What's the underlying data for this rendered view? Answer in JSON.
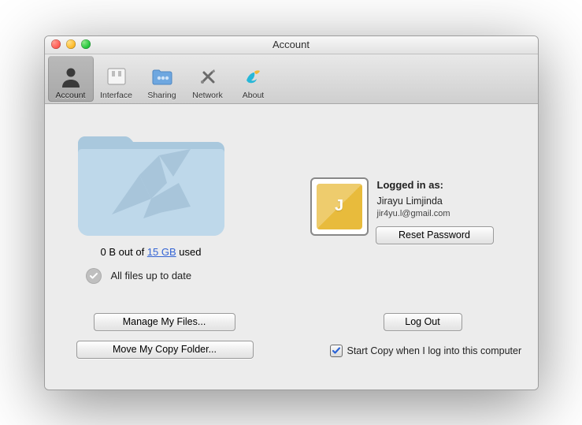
{
  "window": {
    "title": "Account"
  },
  "toolbar": {
    "account": "Account",
    "interface": "Interface",
    "sharing": "Sharing",
    "network": "Network",
    "about": "About"
  },
  "storage": {
    "prefix": "0 B out of ",
    "quota_link": "15 GB",
    "suffix": " used"
  },
  "sync_status": "All files up to date",
  "buttons": {
    "manage": "Manage My Files...",
    "move": "Move My Copy Folder...",
    "logout": "Log Out",
    "reset": "Reset Password"
  },
  "account": {
    "logged_in_label": "Logged in as:",
    "name": "Jirayu Limjinda",
    "email": "jir4yu.l@gmail.com",
    "avatar_letter": "J"
  },
  "autostart": {
    "label": "Start Copy when I log into this computer",
    "checked": true
  }
}
